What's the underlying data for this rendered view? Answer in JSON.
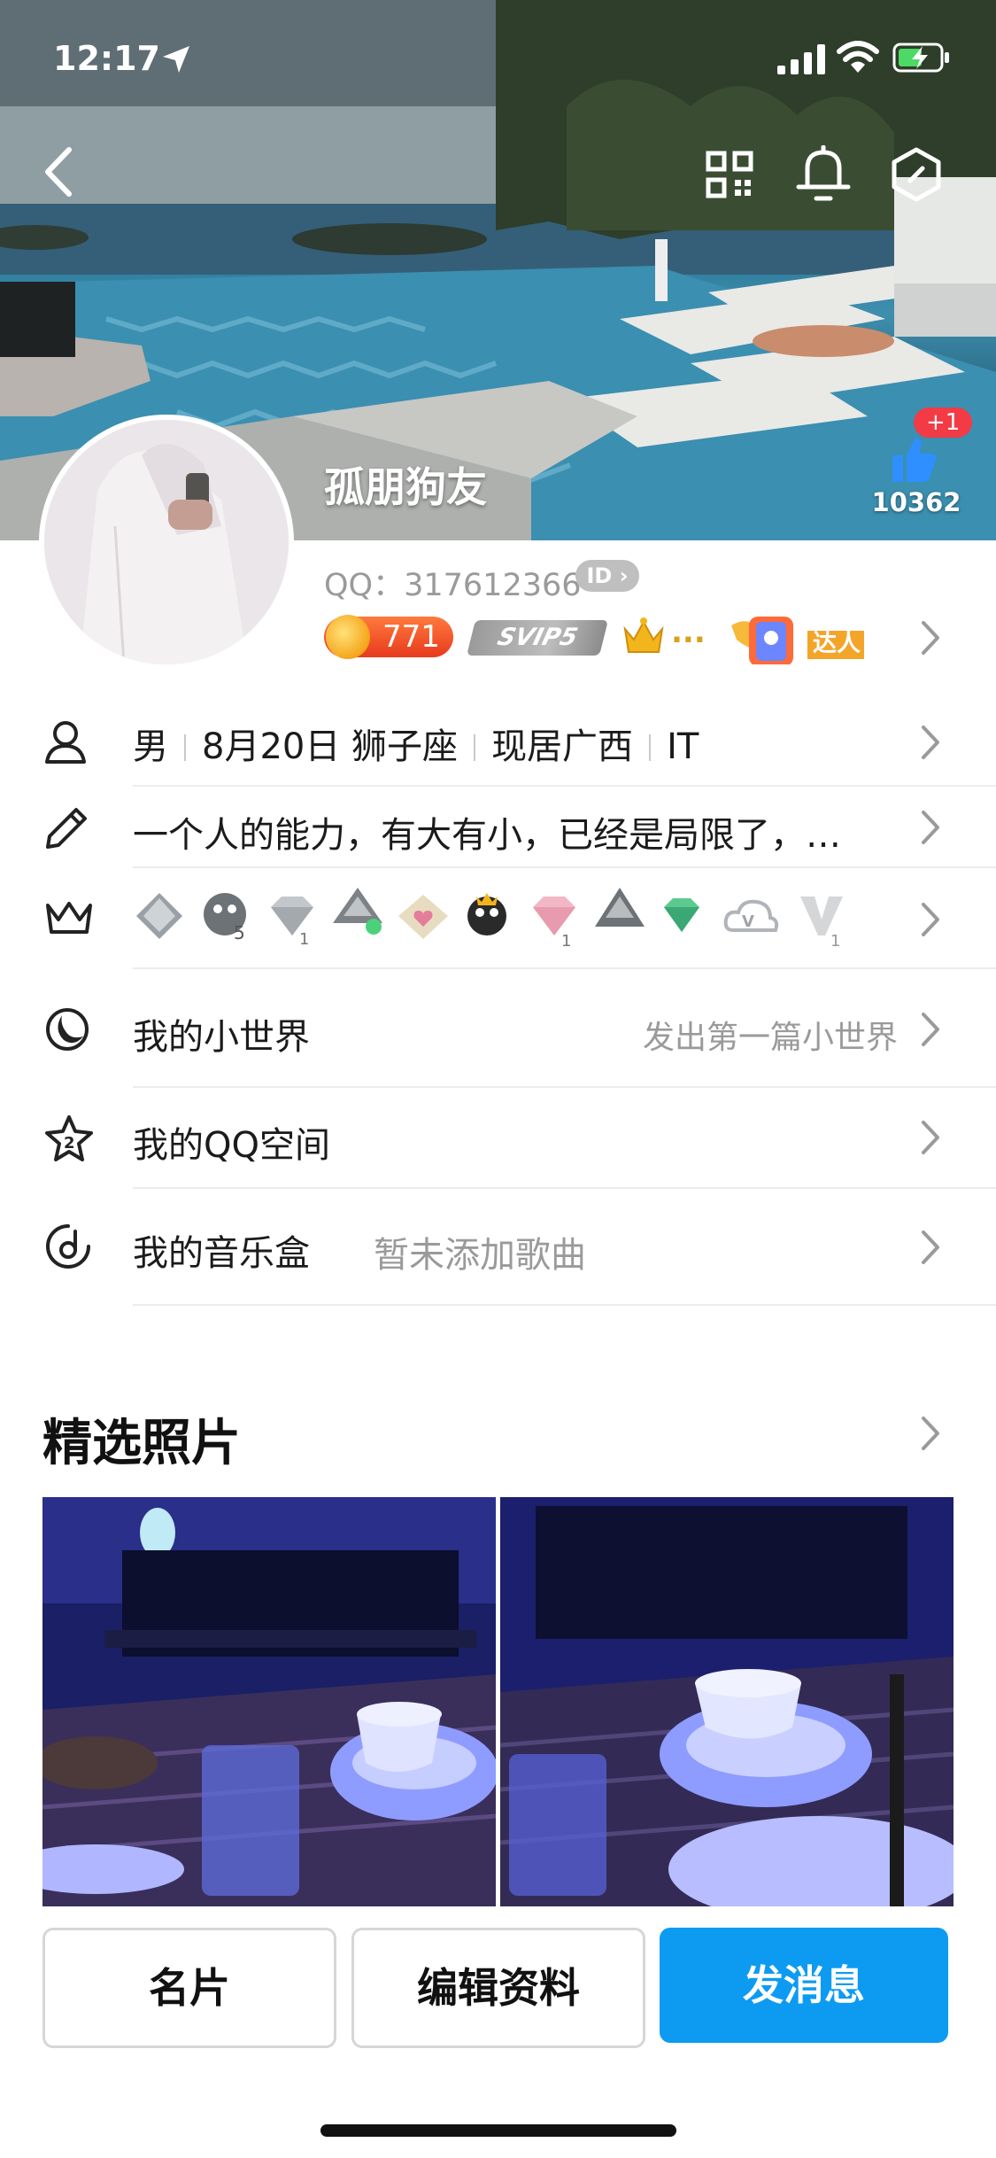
{
  "status_bar": {
    "time": "12:17"
  },
  "profile": {
    "nickname": "孤朋狗友",
    "qq_label": "QQ：",
    "qq_number": "317612366",
    "id_badge": "ID",
    "likes_count": "10362",
    "likes_plus": "+1",
    "coin_value": "771",
    "svip_label": "SVIP5",
    "crown_dots": "...",
    "daren_label": "达人"
  },
  "info_rows": {
    "basic": {
      "gender": "男",
      "birthday": "8月20日 狮子座",
      "location": "现居广西",
      "job": "IT"
    },
    "signature": "一个人的能力，有大有小，已经是局限了，…",
    "world": {
      "label": "我的小世界",
      "hint": "发出第一篇小世界"
    },
    "qzone": {
      "label": "我的QQ空间"
    },
    "music": {
      "label": "我的音乐盒",
      "hint": "暂未添加歌曲"
    }
  },
  "photos": {
    "title": "精选照片"
  },
  "buttons": {
    "card": "名片",
    "edit": "编辑资料",
    "message": "发消息"
  }
}
